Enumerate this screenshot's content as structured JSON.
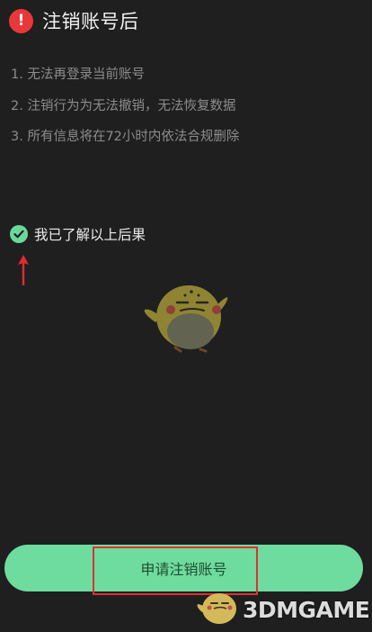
{
  "header": {
    "warning_icon_glyph": "!",
    "title": "注销账号后"
  },
  "consequences": [
    "1. 无法再登录当前账号",
    "2. 注销行为为无法撤销，无法恢复数据",
    "3. 所有信息将在72小时内依法合规删除"
  ],
  "acknowledge": {
    "label": "我已了解以上后果",
    "checked": true
  },
  "action": {
    "label": "申请注销账号"
  },
  "watermark": {
    "text": "3DMGAME"
  },
  "colors": {
    "background": "#1f1f1f",
    "accent_green": "#6edc9e",
    "warning_red": "#e8383a",
    "annotation_red": "#e03030"
  },
  "icons": {
    "warning": "exclamation-circle-icon",
    "check": "check-circle-icon",
    "arrow": "up-arrow-annotation",
    "mascot": "bird-mascot-illustration"
  }
}
